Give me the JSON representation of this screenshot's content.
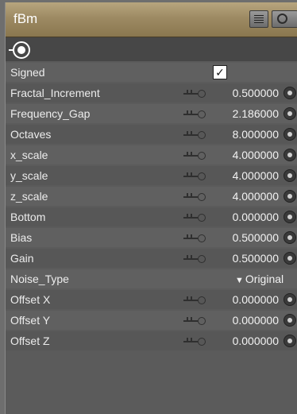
{
  "node": {
    "title": "fBm",
    "title_bar_color": "#a08d66"
  },
  "rows": [
    {
      "label": "Signed",
      "type": "checkbox",
      "checked": true,
      "check_glyph": "✓"
    },
    {
      "label": "Fractal_Increment",
      "type": "numeric",
      "value": "0.500000"
    },
    {
      "label": "Frequency_Gap",
      "type": "numeric",
      "value": "2.186000"
    },
    {
      "label": "Octaves",
      "type": "numeric",
      "value": "8.000000"
    },
    {
      "label": "x_scale",
      "type": "numeric",
      "value": "4.000000"
    },
    {
      "label": "y_scale",
      "type": "numeric",
      "value": "4.000000"
    },
    {
      "label": "z_scale",
      "type": "numeric",
      "value": "4.000000"
    },
    {
      "label": "Bottom",
      "type": "numeric",
      "value": "0.000000"
    },
    {
      "label": "Bias",
      "type": "numeric",
      "value": "0.500000"
    },
    {
      "label": "Gain",
      "type": "numeric",
      "value": "0.500000"
    },
    {
      "label": "Noise_Type",
      "type": "dropdown",
      "value": "Original",
      "arrow": "▼"
    },
    {
      "label": "Offset X",
      "type": "numeric",
      "value": "0.000000"
    },
    {
      "label": "Offset Y",
      "type": "numeric",
      "value": "0.000000"
    },
    {
      "label": "Offset Z",
      "type": "numeric",
      "value": "0.000000"
    }
  ],
  "icons": {
    "title_buttons": [
      "list-icon",
      "collapse-icon"
    ],
    "input_connector": "input-plug-icon",
    "row_slider": "slider-dial-icon",
    "row_connector": "parameter-connector-icon"
  }
}
